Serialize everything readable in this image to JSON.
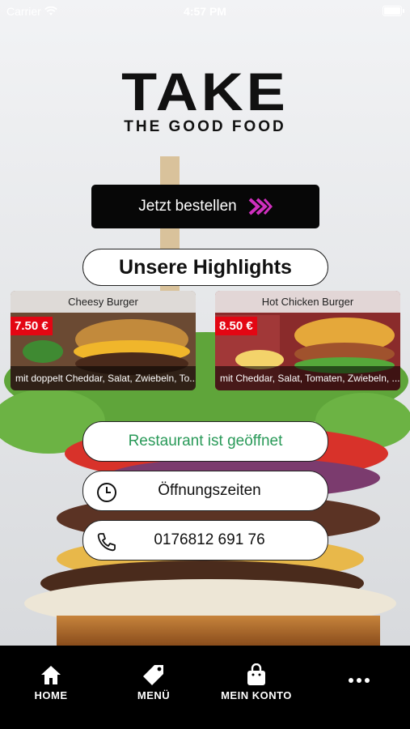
{
  "status_bar": {
    "carrier": "Carrier",
    "time": "4:57 PM"
  },
  "logo": {
    "title": "TAKE",
    "subtitle": "THE GOOD FOOD"
  },
  "order_button": {
    "label": "Jetzt bestellen",
    "icon": "double-chevron-right-icon"
  },
  "highlights": {
    "heading": "Unsere Highlights",
    "items": [
      {
        "title": "Cheesy Burger",
        "price": "7.50 €",
        "description": "mit doppelt Cheddar, Salat, Zwiebeln, To..."
      },
      {
        "title": "Hot Chicken Burger",
        "price": "8.50 €",
        "description": "mit Cheddar, Salat, Tomaten, Zwiebeln, ..."
      }
    ]
  },
  "info": {
    "open_status": "Restaurant ist geöffnet",
    "hours_label": "Öffnungszeiten",
    "phone": "0176812 691 76"
  },
  "colors": {
    "accent": "#d02fbe",
    "open_green": "#2a9a59",
    "price_red": "#e30613"
  },
  "tabbar": [
    {
      "label": "HOME",
      "icon": "home-icon"
    },
    {
      "label": "MENÜ",
      "icon": "tag-icon"
    },
    {
      "label": "MEIN KONTO",
      "icon": "shopping-bag-icon"
    },
    {
      "label": "",
      "icon": "more-icon"
    }
  ]
}
